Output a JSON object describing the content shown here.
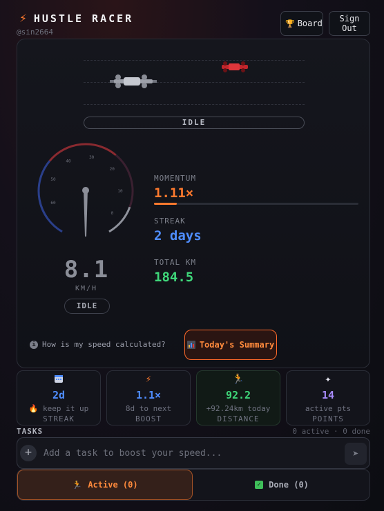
{
  "header": {
    "brand_icon": "lightning-bolt-icon",
    "title": "HUSTLE RACER",
    "username": "@sin2664",
    "board_label": "Board",
    "signout_label": "Sign Out"
  },
  "race": {
    "status": "IDLE",
    "speed": "8.1",
    "speed_unit": "KM/H",
    "speed_status": "IDLE",
    "speed_level": 0.13,
    "gauge_ticks": [
      "0",
      "10",
      "20",
      "30",
      "40",
      "50",
      "60"
    ]
  },
  "stats": {
    "momentum_label": "MOMENTUM",
    "momentum_value": "1.11×",
    "momentum_fraction": 0.11,
    "streak_label": "STREAK",
    "streak_value": "2 days",
    "total_label": "TOTAL KM",
    "total_value": "184.5"
  },
  "help_text": "How is my speed calculated?",
  "summary_label": "Today's Summary",
  "cards": [
    {
      "icon": "calendar-icon",
      "value": "2d",
      "sub": "keep it up",
      "label": "STREAK",
      "color": "#4f8dff"
    },
    {
      "icon": "lightning-bolt-icon",
      "value": "1.1×",
      "sub": "8d to next",
      "label": "BOOST",
      "color": "#4f8dff"
    },
    {
      "icon": "runner-icon",
      "value": "92.2",
      "sub": "+92.24km today",
      "label": "DISTANCE",
      "color": "#3fd77a"
    },
    {
      "icon": "sparkle-icon",
      "value": "14",
      "sub": "active pts",
      "label": "POINTS",
      "color": "#a78bfa"
    }
  ],
  "tasks": {
    "label": "TASKS",
    "count": "0 active · 0 done",
    "placeholder": "Add a task to boost your speed...",
    "tab_active": "Active (0)",
    "tab_done": "Done (0)"
  },
  "colors": {
    "accent": "#ff7a2e",
    "blue": "#4f8dff",
    "green": "#3fd77a",
    "purple": "#a78bfa"
  }
}
